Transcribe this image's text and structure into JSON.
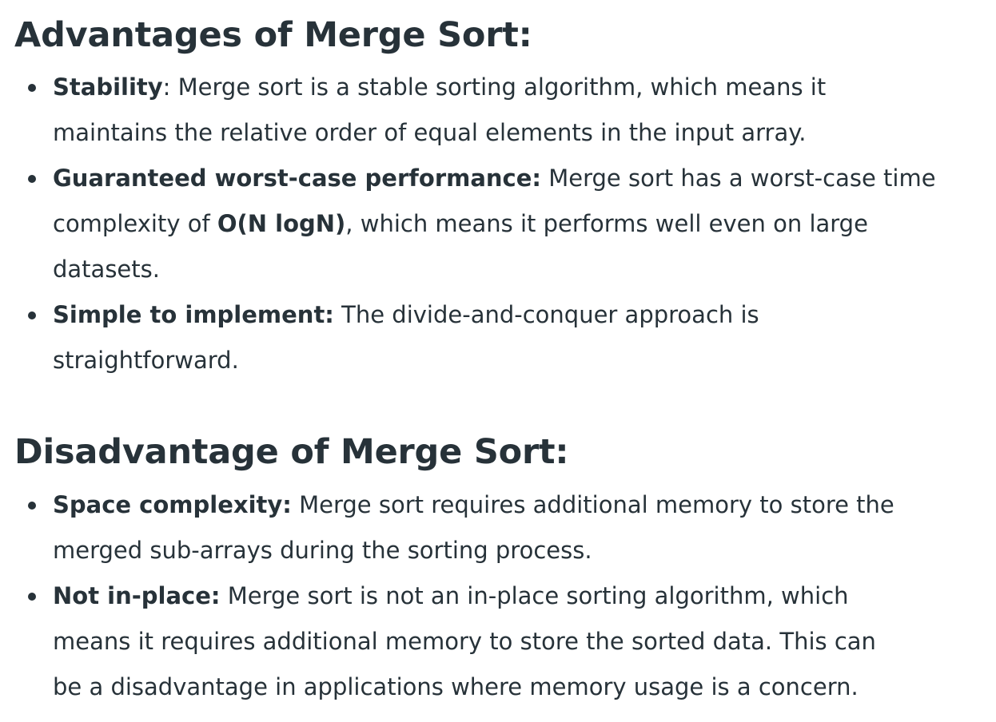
{
  "advantages": {
    "heading": "Advantages of Merge Sort:",
    "items": [
      {
        "term": "Stability",
        "line1": ": Merge sort is a stable sorting algorithm, which means it",
        "line2": "maintains the relative order of equal elements in the input array."
      },
      {
        "term": "Guaranteed worst-case performance:",
        "line1": " Merge sort has a worst-case time",
        "line2_pre": "complexity of ",
        "line2_bold": "O(N logN)",
        "line2_post": ", which means it performs well even on large",
        "line3": "datasets."
      },
      {
        "term": "Simple to implement:",
        "line1": " The divide-and-conquer approach is",
        "line2": "straightforward."
      }
    ]
  },
  "disadvantages": {
    "heading": "Disadvantage of Merge Sort:",
    "items": [
      {
        "term": "Space complexity:",
        "line1": " Merge sort requires additional memory to store the",
        "line2": "merged sub-arrays during the sorting process."
      },
      {
        "term": "Not in-place:",
        "line1": " Merge sort is not an in-place sorting algorithm, which",
        "line2": "means it requires additional memory to store the sorted data. This can",
        "line3": "be a disadvantage in applications where memory usage is a concern."
      }
    ]
  }
}
